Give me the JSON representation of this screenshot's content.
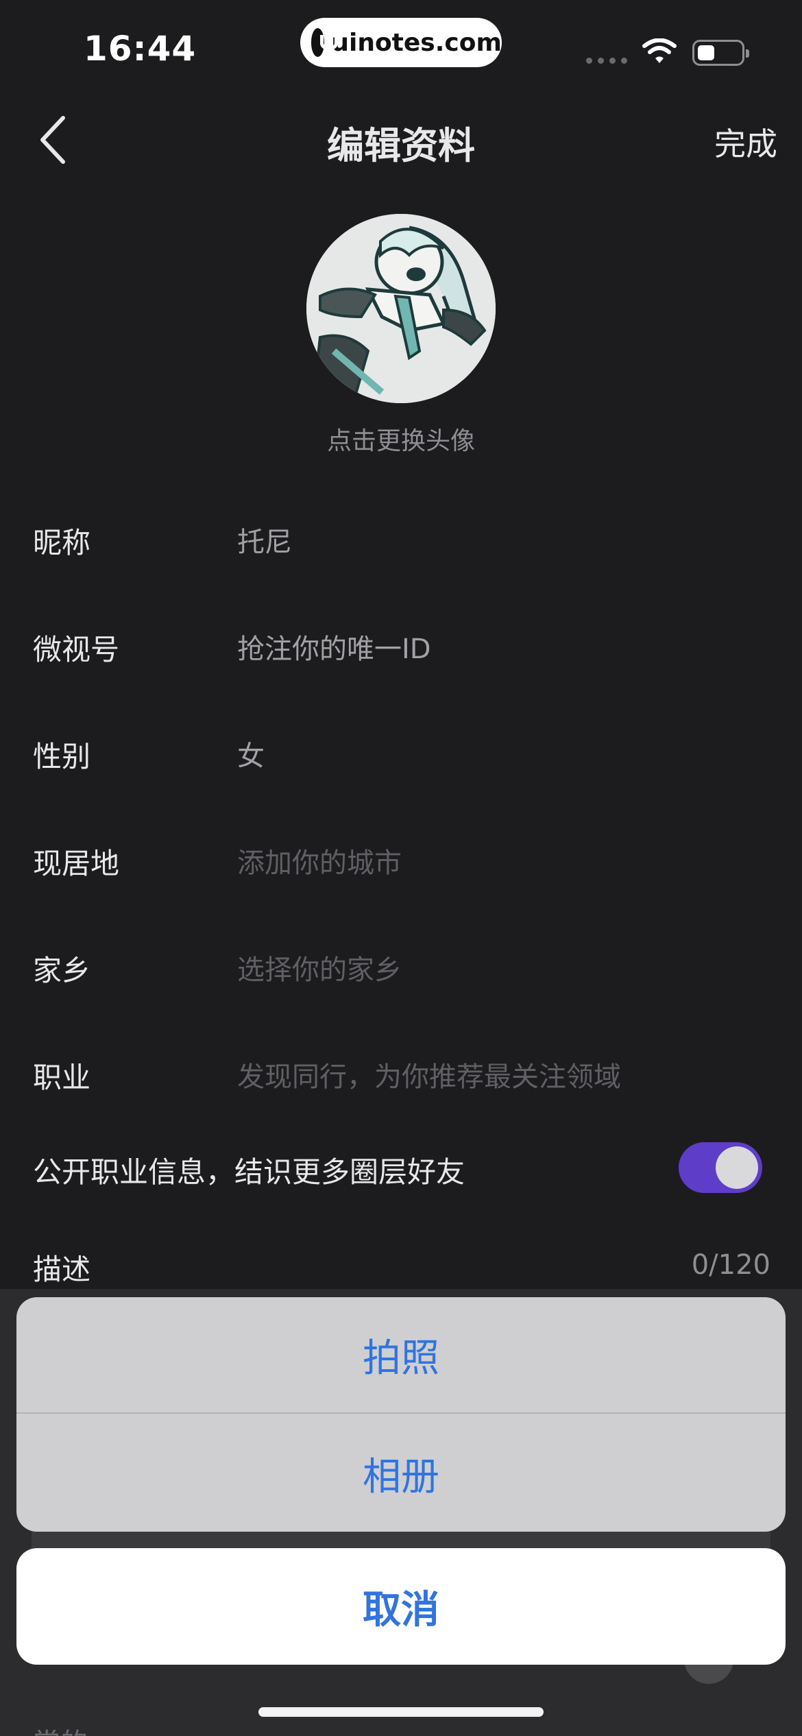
{
  "status_bar": {
    "time": "16:44",
    "badge_text": "uinotes.com"
  },
  "nav": {
    "title": "编辑资料",
    "done_label": "完成",
    "back_icon": "chevron-left-icon"
  },
  "avatar": {
    "hint": "点击更换头像"
  },
  "form": {
    "rows": [
      {
        "label": "昵称",
        "value": "托尼"
      },
      {
        "label": "微视号",
        "value": "抢注你的唯一ID"
      },
      {
        "label": "性别",
        "value": "女"
      },
      {
        "label": "现居地",
        "value": "添加你的城市"
      },
      {
        "label": "家乡",
        "value": "选择你的家乡"
      },
      {
        "label": "职业",
        "value": "发现同行，为你推荐最关注领域"
      }
    ],
    "toggle_label": "公开职业信息，结识更多圈层好友",
    "toggle_on": true,
    "toggle_color": "#5e3ec9",
    "description_label": "描述",
    "description_count": "0/120"
  },
  "action_sheet": {
    "take_photo": "拍照",
    "album": "相册",
    "cancel": "取消",
    "accent_color": "#2f74e0"
  },
  "background_hint": "常的"
}
